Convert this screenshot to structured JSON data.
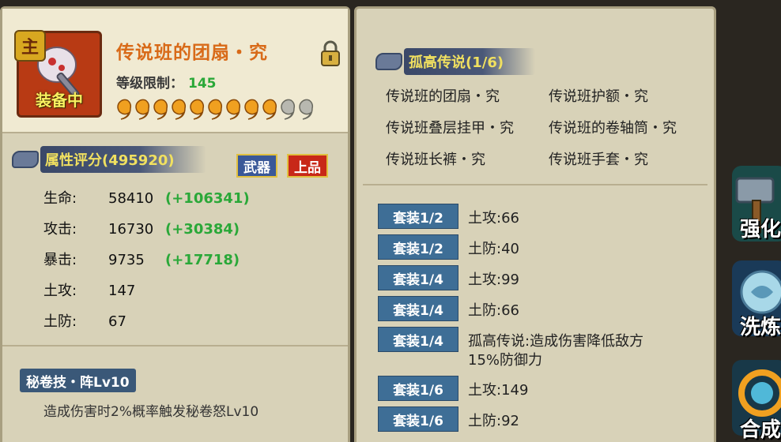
{
  "item": {
    "equipped_label": "装备中",
    "name": "传说班的团扇・究",
    "level_label": "等级限制：",
    "level_value": "145",
    "stars_filled": 9,
    "stars_total": 11,
    "badge_char": "主"
  },
  "attributes": {
    "header": "属性评分(495920)",
    "tag_type": "武器",
    "tag_grade": "上品",
    "stats": [
      {
        "label": "生命:",
        "value": "58410",
        "bonus": "(+106341)"
      },
      {
        "label": "攻击:",
        "value": "16730",
        "bonus": "(+30384)"
      },
      {
        "label": "暴击:",
        "value": "9735",
        "bonus": "(+17718)"
      },
      {
        "label": "土攻:",
        "value": "147",
        "bonus": ""
      },
      {
        "label": "土防:",
        "value": "67",
        "bonus": ""
      }
    ]
  },
  "skill": {
    "header": "秘卷技・阵Lv10",
    "description": "造成伤害时2%概率触发秘卷怒Lv10"
  },
  "set": {
    "header": "孤高传说(1/6)",
    "pieces": [
      "传说班的团扇・究",
      "传说班护额・究",
      "传说班叠层挂甲・究",
      "传说班的卷轴筒・究",
      "传说班长裤・究",
      "传说班手套・究"
    ],
    "bonuses": [
      {
        "badge": "套装1/2",
        "text": "土攻:66"
      },
      {
        "badge": "套装1/2",
        "text": "土防:40"
      },
      {
        "badge": "套装1/4",
        "text": "土攻:99"
      },
      {
        "badge": "套装1/4",
        "text": "土防:66"
      },
      {
        "badge": "套装1/4",
        "text": "孤高传说:造成伤害降低敌方",
        "text2": "15%防御力"
      },
      {
        "badge": "套装1/6",
        "text": "土攻:149"
      },
      {
        "badge": "套装1/6",
        "text": "土防:92"
      }
    ]
  },
  "side_buttons": [
    {
      "label": "强化",
      "icon": "hammer-icon"
    },
    {
      "label": "洗炼",
      "icon": "swirl-icon"
    },
    {
      "label": "合成",
      "icon": "combine-icon"
    }
  ],
  "colors": {
    "panel": "#d8d2b8",
    "accent_orange": "#d86a18",
    "bonus_green": "#2aa838",
    "header_yellow": "#f0e060",
    "badge_blue": "#3e6e96"
  }
}
